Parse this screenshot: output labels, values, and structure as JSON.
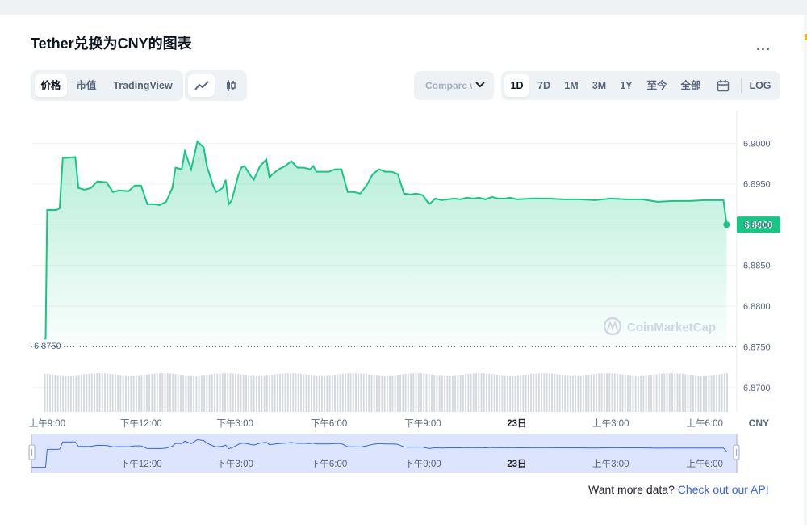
{
  "title": "Tether兑换为CNY的图表",
  "more_label": "...",
  "view_tabs": [
    "价格",
    "市值",
    "TradingView"
  ],
  "compare_label": "Compare with",
  "range_tabs": [
    "1D",
    "7D",
    "1M",
    "3M",
    "1Y",
    "至今",
    "全部"
  ],
  "log_label": "LOG",
  "watermark": "CoinMarketCap",
  "footer": {
    "text": "Want more data?",
    "link": "Check out our API"
  },
  "colors": {
    "line": "#16c784",
    "accent": "#3861fb",
    "navigator": "#dde4fd"
  },
  "chart_data": {
    "type": "area",
    "y_axis_title": "CNY",
    "ylim": [
      6.867,
      6.904
    ],
    "y_ticks": [
      "6.9000",
      "6.8950",
      "6.8900",
      "6.8850",
      "6.8800",
      "6.8750",
      "6.8700"
    ],
    "x_ticks": [
      "上午9:00",
      "下午12:00",
      "下午3:00",
      "下午6:00",
      "下午9:00",
      "23日",
      "上午3:00",
      "上午6:00"
    ],
    "navigator_ticks": [
      "下午12:00",
      "下午3:00",
      "下午6:00",
      "下午9:00",
      "23日",
      "上午3:00",
      "上午6:00"
    ],
    "current_price": "6.8900",
    "open_label": "6.8750",
    "series": [
      {
        "x": [
          8.9,
          8.95,
          9.0,
          9.3,
          9.4,
          9.5,
          9.6,
          9.9,
          10.0,
          10.2,
          10.4,
          10.6,
          10.9,
          11.1,
          11.3,
          11.6,
          11.8,
          12.0,
          12.2,
          12.4,
          12.6,
          12.8,
          13.0,
          13.1,
          13.3,
          13.4,
          13.6,
          13.8,
          14.0,
          14.1,
          14.3,
          14.4,
          14.6,
          14.7,
          14.8,
          14.9,
          15.0,
          15.1,
          15.2,
          15.3,
          15.5,
          15.6,
          15.8,
          16.0,
          16.1,
          16.2,
          16.4,
          16.6,
          16.8,
          17.0,
          17.2,
          17.4,
          17.5,
          17.6,
          17.8,
          18.0,
          18.2,
          18.4,
          18.6,
          18.8,
          19.0,
          19.2,
          19.4,
          19.6,
          19.8,
          20.0,
          20.2,
          20.4,
          20.6,
          20.8,
          21.0,
          21.2,
          21.4,
          21.6,
          21.8,
          22.0,
          22.2,
          22.4,
          22.6,
          22.8,
          23.0,
          23.2,
          23.4,
          23.6,
          23.8,
          24.0,
          24.5,
          25.0,
          25.5,
          26.0,
          26.5,
          27.0,
          27.5,
          28.0,
          28.5,
          29.0,
          29.5,
          30.0,
          30.5,
          30.6,
          30.7
        ],
        "y": [
          6.876,
          6.876,
          6.8918,
          6.8918,
          6.892,
          6.8982,
          6.8982,
          6.8983,
          6.8945,
          6.8943,
          6.8945,
          6.8953,
          6.8952,
          6.894,
          6.8942,
          6.8941,
          6.8948,
          6.8948,
          6.8925,
          6.8925,
          6.8924,
          6.8928,
          6.8945,
          6.897,
          6.8968,
          6.899,
          6.8968,
          6.9002,
          6.8995,
          6.8972,
          6.8948,
          6.894,
          6.8945,
          6.8955,
          6.8925,
          6.893,
          6.8945,
          6.896,
          6.897,
          6.8972,
          6.896,
          6.8955,
          6.8972,
          6.898,
          6.8958,
          6.8962,
          6.8968,
          6.8972,
          6.8978,
          6.897,
          6.897,
          6.8968,
          6.8972,
          6.8965,
          6.8965,
          6.8965,
          6.8968,
          6.8968,
          6.894,
          6.894,
          6.8938,
          6.8948,
          6.8962,
          6.8968,
          6.8965,
          6.8965,
          6.8962,
          6.8938,
          6.8937,
          6.8938,
          6.8936,
          6.8925,
          6.8932,
          6.893,
          6.8931,
          6.8932,
          6.8931,
          6.8933,
          6.8932,
          6.8933,
          6.8931,
          6.8934,
          6.8932,
          6.8932,
          6.8933,
          6.8931,
          6.8932,
          6.8932,
          6.8931,
          6.8931,
          6.893,
          6.8932,
          6.8931,
          6.8931,
          6.8928,
          6.8929,
          6.8929,
          6.893,
          6.893,
          6.893,
          6.89
        ]
      }
    ],
    "volume": {
      "shown": true,
      "relative": 0.92
    },
    "grid": true
  }
}
